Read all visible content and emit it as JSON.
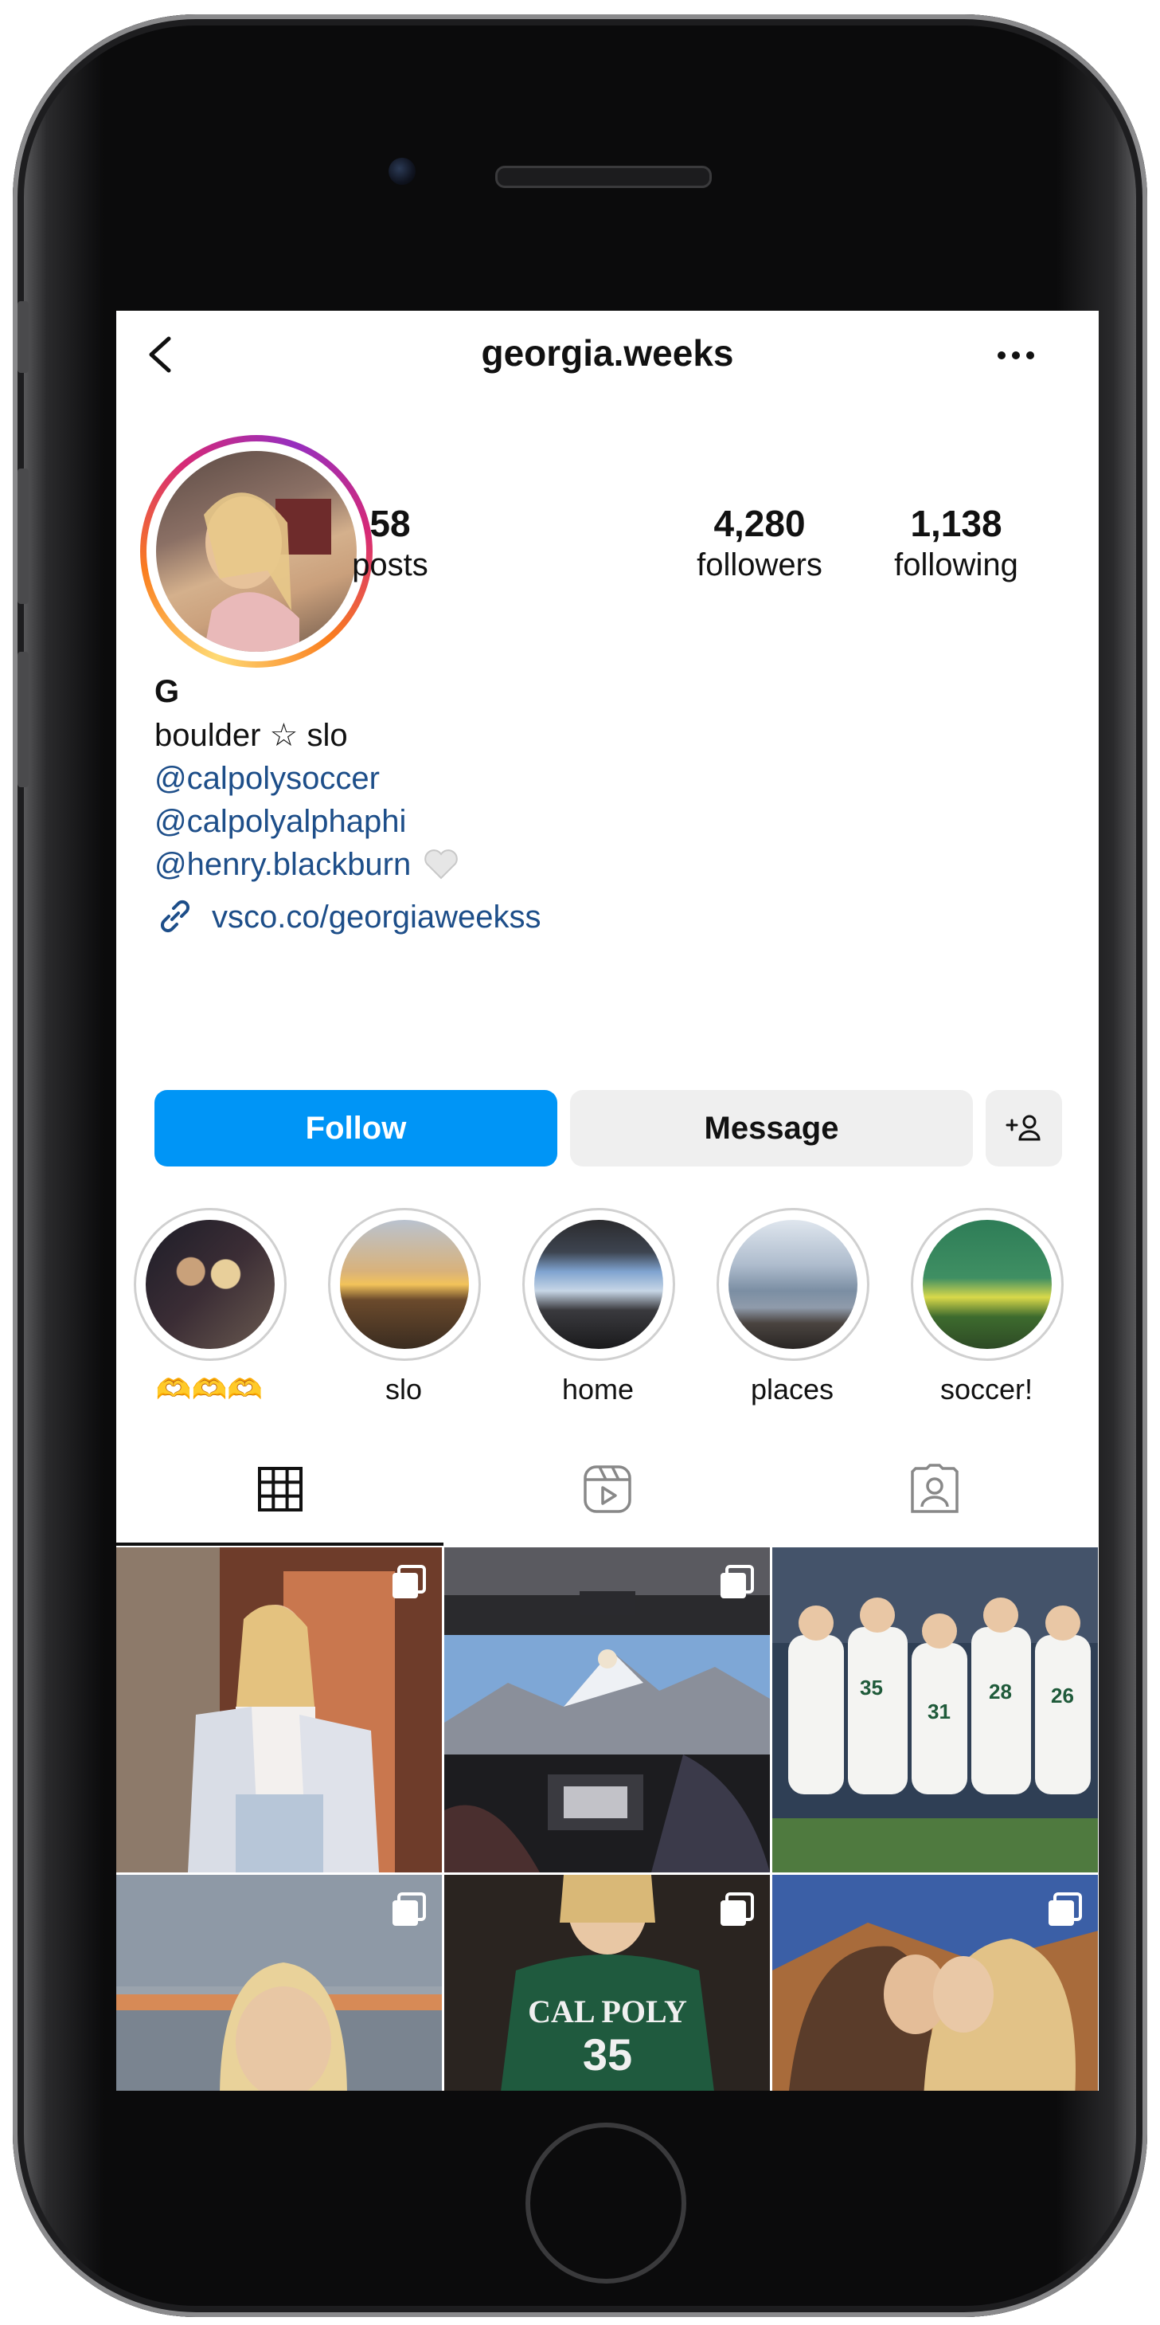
{
  "header": {
    "username": "georgia.weeks"
  },
  "stats": {
    "posts": {
      "value": "58",
      "label": "posts"
    },
    "followers": {
      "value": "4,280",
      "label": "followers"
    },
    "following": {
      "value": "1,138",
      "label": "following"
    }
  },
  "bio": {
    "name": "G",
    "line": "boulder ☆ slo",
    "mentions": [
      "@calpolysoccer",
      "@calpolyalphaphi",
      "@henry.blackburn"
    ],
    "link": "vsco.co/georgiaweekss"
  },
  "actions": {
    "follow": "Follow",
    "message": "Message"
  },
  "highlights": [
    {
      "label": "🫶🫶🫶",
      "icon": "highlight-friends"
    },
    {
      "label": "slo",
      "icon": "highlight-sunset"
    },
    {
      "label": "home",
      "icon": "highlight-car"
    },
    {
      "label": "places",
      "icon": "highlight-lake"
    },
    {
      "label": "soccer!",
      "icon": "highlight-soccer"
    }
  ],
  "tabs": [
    "grid-icon",
    "reels-icon",
    "tagged-icon"
  ],
  "colors": {
    "follow_button": "#0095f6",
    "link_text": "#1d4e89",
    "secondary_button": "#efefef"
  }
}
